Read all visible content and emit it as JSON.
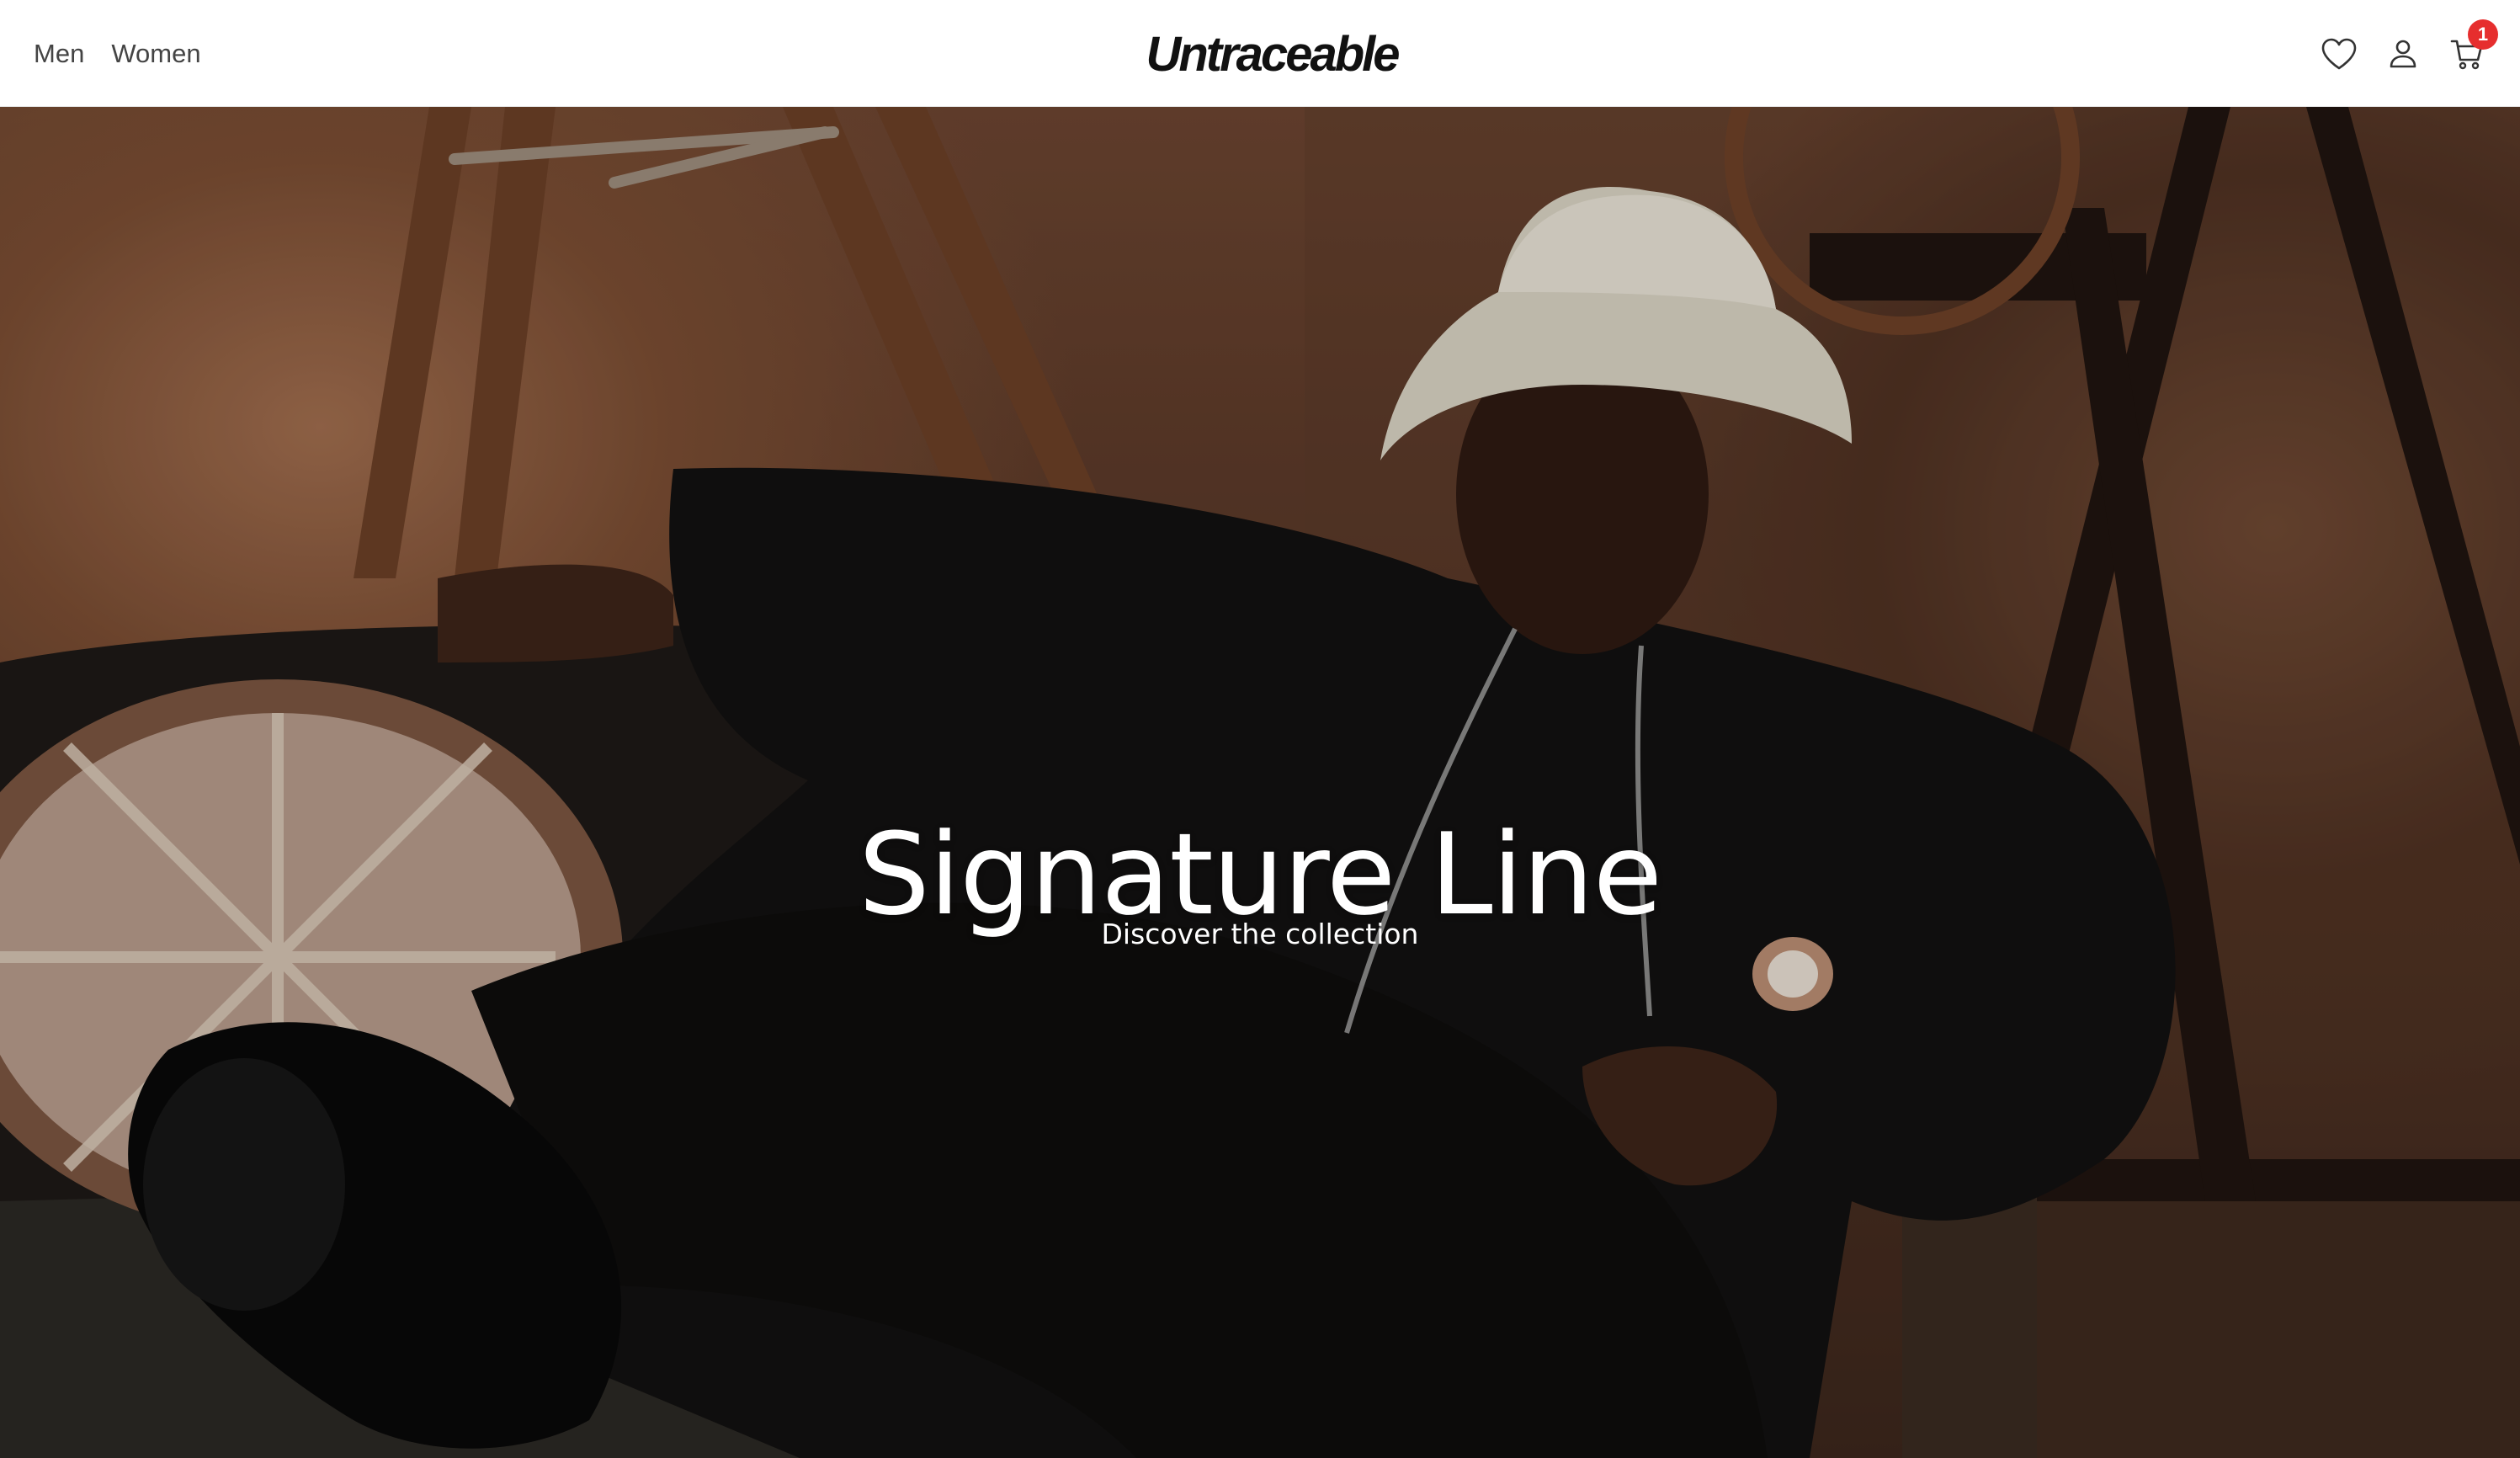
{
  "header": {
    "nav": [
      {
        "label": "Men"
      },
      {
        "label": "Women"
      }
    ],
    "brand": "Untraceable",
    "icons": {
      "wishlist": "heart-icon",
      "account": "user-icon",
      "cart": "cart-icon"
    },
    "cart_count": "1"
  },
  "hero": {
    "title": "Signature Line",
    "subtitle": "Discover the collection"
  },
  "colors": {
    "badge": "#e62e2e",
    "header_bg": "#ffffff",
    "nav_text": "#444444",
    "brand_text": "#111111"
  }
}
